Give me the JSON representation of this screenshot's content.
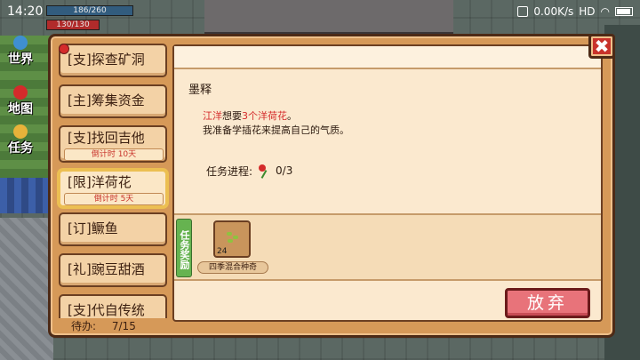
{
  "status_bar": {
    "time": "14:20",
    "network_speed": "0.00K/s",
    "network_type": "HD",
    "icons": [
      "signal-icon",
      "wifi-icon",
      "battery-icon"
    ]
  },
  "hud": {
    "blue_bar_text": "186/260",
    "red_bar_text": "130/130"
  },
  "sidenav": {
    "items": [
      {
        "label": "世界",
        "icon": "globe-icon"
      },
      {
        "label": "地图",
        "icon": "map-pin-icon"
      },
      {
        "label": "任务",
        "icon": "quest-pin-icon"
      }
    ]
  },
  "quest_list": {
    "items": [
      {
        "label": "[支]探查矿洞"
      },
      {
        "label": "[主]筹集资金"
      },
      {
        "label": "[支]找回吉他",
        "timer": "倒计时 10天"
      },
      {
        "label": "[限]洋荷花",
        "timer": "倒计时 5天",
        "selected": true
      },
      {
        "label": "[订]鳜鱼"
      },
      {
        "label": "[礼]豌豆甜酒"
      },
      {
        "label": "[支]代自传统"
      }
    ],
    "pending_label": "待办:",
    "pending_value": "7/15"
  },
  "detail": {
    "npc_name": "墨释",
    "desc_npc": "江洋",
    "desc_mid": "想要",
    "desc_target": "3个洋荷花",
    "desc_end": "。",
    "desc_line2": "我准备学插花来提高自己的气质。",
    "progress_label": "任务进程:",
    "progress_value": "0/3",
    "reward_tab_label": "任务奖励",
    "reward_item_count": "24",
    "reward_item_name": "四季混合种奇"
  },
  "buttons": {
    "close": "✖",
    "abandon": "放弃"
  },
  "colors": {
    "panel_bg": "#d69958",
    "highlight_red": "#d42b2b",
    "reward_tab_green": "#66b350",
    "abandon_button": "#e8737a"
  }
}
